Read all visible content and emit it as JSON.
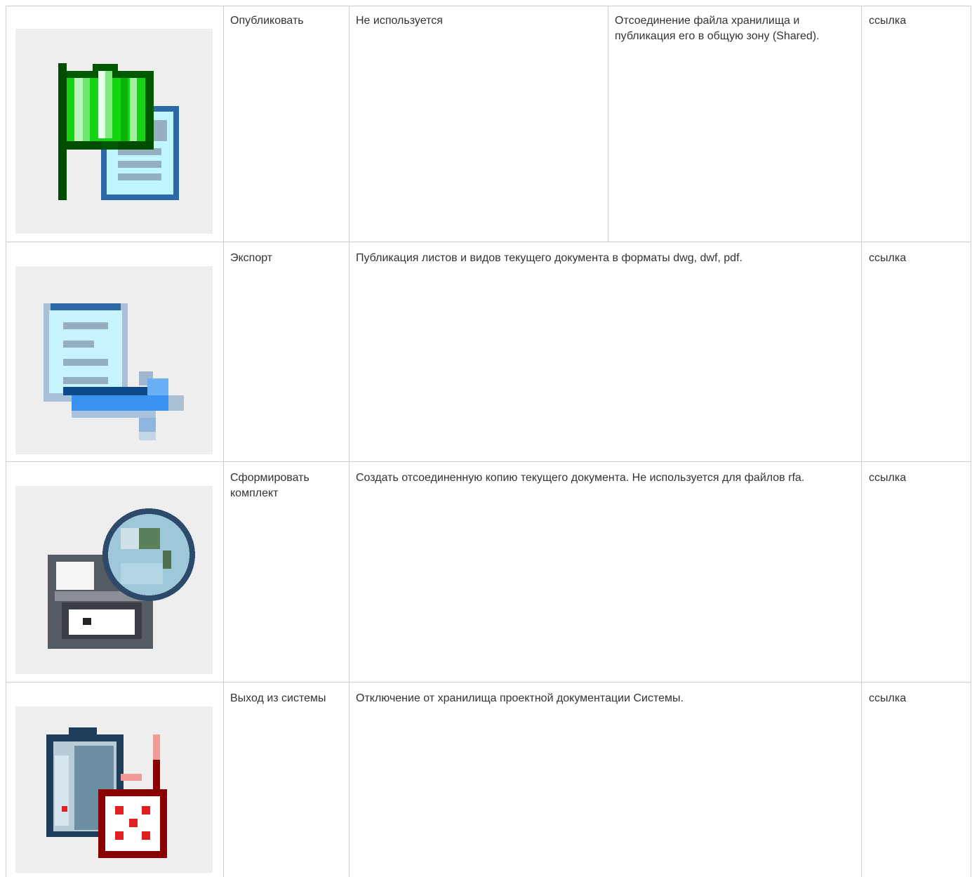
{
  "rows": [
    {
      "icon": "publish-flag-icon",
      "name": "Опубликовать",
      "col3": "Не используется",
      "col4": "Отсоединение файла хранилища и публикация его в общую зону (Shared).",
      "link": "ссылка"
    },
    {
      "icon": "export-document-icon",
      "name": "Экспорт",
      "description": "Публикация листов и видов текущего документа в форматы dwg, dwf, pdf.",
      "link": "ссылка"
    },
    {
      "icon": "create-package-icon",
      "name": "Сформировать комплект",
      "description": "Создать отсоединенную копию текущего документа. Не используется для файлов rfa.",
      "link": "ссылка"
    },
    {
      "icon": "logout-icon",
      "name": "Выход из системы",
      "description": "Отключение от хранилища проектной документации Системы.",
      "link": "ссылка"
    }
  ]
}
